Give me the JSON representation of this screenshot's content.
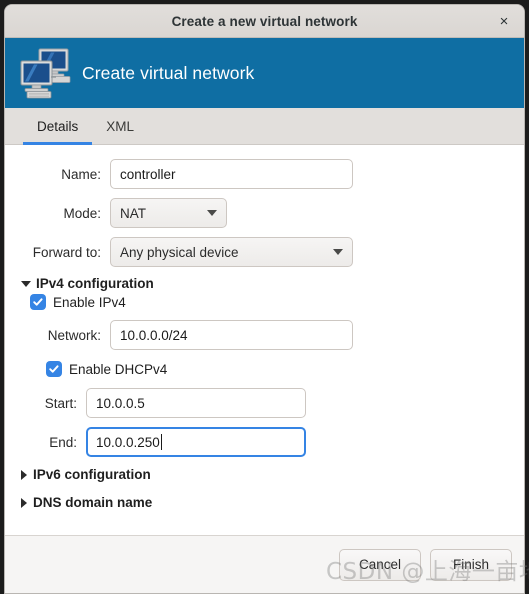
{
  "window": {
    "title": "Create a new virtual network",
    "close_label": "×"
  },
  "header": {
    "title": "Create virtual network",
    "icon": "two-monitors-network-icon",
    "background_color": "#0f6ea3"
  },
  "tabs": [
    {
      "label": "Details",
      "active": true
    },
    {
      "label": "XML",
      "active": false
    }
  ],
  "form": {
    "name": {
      "label": "Name:",
      "value": "controller",
      "placeholder": ""
    },
    "mode": {
      "label": "Mode:",
      "value": "NAT"
    },
    "forward_to": {
      "label": "Forward to:",
      "value": "Any physical device"
    },
    "ipv4_section": {
      "label": "IPv4 configuration",
      "expanded": true,
      "enable_ipv4": {
        "label": "Enable IPv4",
        "checked": true
      },
      "network": {
        "label": "Network:",
        "value": "10.0.0.0/24"
      },
      "enable_dhcpv4": {
        "label": "Enable DHCPv4",
        "checked": true
      },
      "start": {
        "label": "Start:",
        "value": "10.0.0.5"
      },
      "end": {
        "label": "End:",
        "value": "10.0.0.250",
        "focused": true
      }
    },
    "ipv6_section": {
      "label": "IPv6 configuration",
      "expanded": false
    },
    "dns_section": {
      "label": "DNS domain name",
      "expanded": false
    }
  },
  "actions": {
    "cancel_label": "Cancel",
    "finish_label": "Finish"
  },
  "watermark": {
    "text": "CSDN @上海一亩地"
  },
  "colors": {
    "accent": "#3584e4",
    "header": "#0f6ea3",
    "chrome": "#f6f5f4"
  }
}
